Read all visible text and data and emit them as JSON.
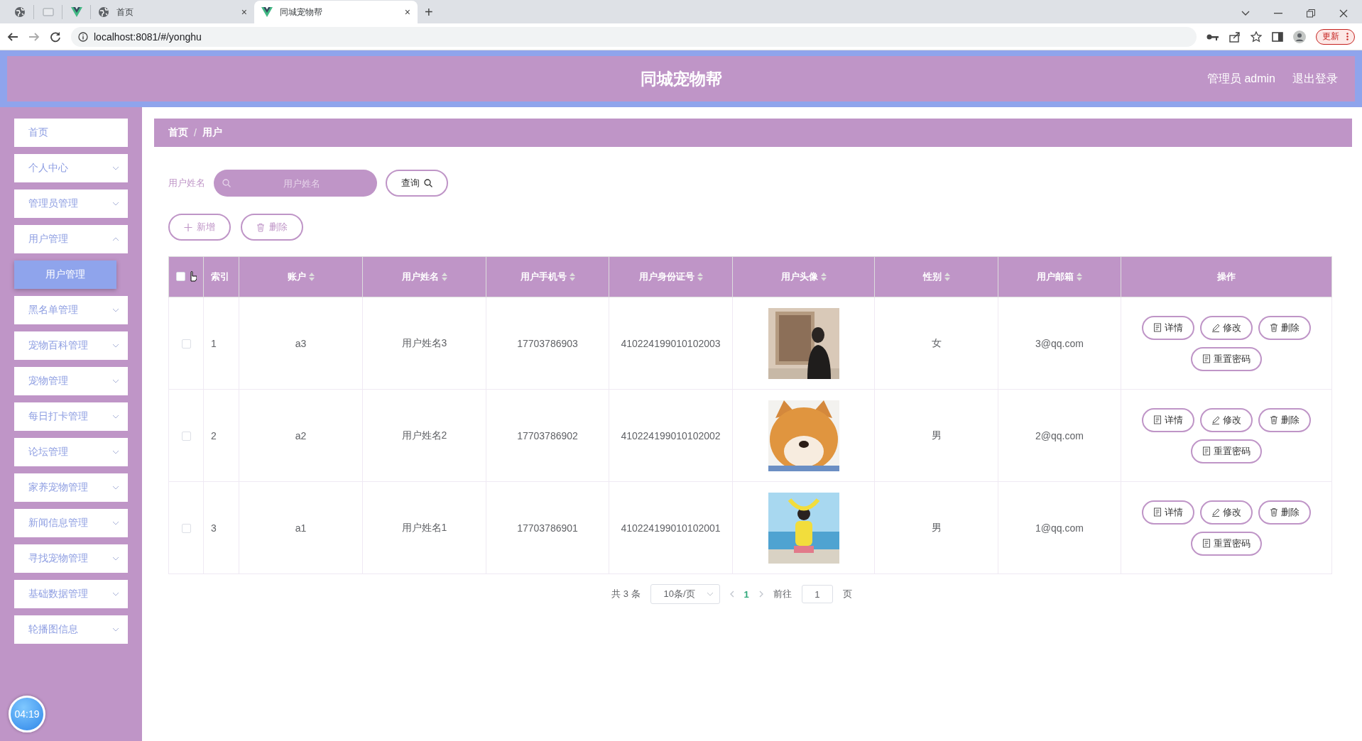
{
  "browser": {
    "tabs": [
      {
        "kind": "globe",
        "selected": false
      },
      {
        "kind": "blank",
        "selected": false
      },
      {
        "kind": "vue",
        "selected": false
      },
      {
        "kind": "globe",
        "title": "首页",
        "close": "×",
        "selected": false
      },
      {
        "kind": "vue",
        "title": "同城宠物帮",
        "close": "×",
        "selected": true
      }
    ],
    "new_tab": "+",
    "url": "localhost:8081/#/yonghu",
    "update_button": "更新"
  },
  "header": {
    "title": "同城宠物帮",
    "user": "管理员 admin",
    "logout": "退出登录"
  },
  "sidebar": {
    "items": [
      {
        "label": "首页",
        "kind": "link"
      },
      {
        "label": "个人中心",
        "kind": "menu",
        "expanded": false
      },
      {
        "label": "管理员管理",
        "kind": "menu",
        "expanded": false
      },
      {
        "label": "用户管理",
        "kind": "menu",
        "expanded": true,
        "children": [
          {
            "label": "用户管理",
            "selected": true
          }
        ]
      },
      {
        "label": "黑名单管理",
        "kind": "menu",
        "expanded": false
      },
      {
        "label": "宠物百科管理",
        "kind": "menu",
        "expanded": false
      },
      {
        "label": "宠物管理",
        "kind": "menu",
        "expanded": false
      },
      {
        "label": "每日打卡管理",
        "kind": "menu",
        "expanded": false
      },
      {
        "label": "论坛管理",
        "kind": "menu",
        "expanded": false
      },
      {
        "label": "家养宠物管理",
        "kind": "menu",
        "expanded": false
      },
      {
        "label": "新闻信息管理",
        "kind": "menu",
        "expanded": false
      },
      {
        "label": "寻找宠物管理",
        "kind": "menu",
        "expanded": false
      },
      {
        "label": "基础数据管理",
        "kind": "menu",
        "expanded": false
      },
      {
        "label": "轮播图信息",
        "kind": "menu",
        "expanded": false
      }
    ],
    "clock": "04:19"
  },
  "breadcrumb": [
    "首页",
    "/",
    "用户"
  ],
  "search": {
    "label": "用户姓名",
    "placeholder": "用户姓名",
    "button": "查询"
  },
  "toolbar": [
    "新增",
    "删除"
  ],
  "table": {
    "select_all": {
      "checked": false
    },
    "columns": [
      {
        "label": "索引",
        "sortable": false
      },
      {
        "label": "账户",
        "sortable": true
      },
      {
        "label": "用户姓名",
        "sortable": true
      },
      {
        "label": "用户手机号",
        "sortable": true
      },
      {
        "label": "用户身份证号",
        "sortable": true
      },
      {
        "label": "用户头像",
        "sortable": true
      },
      {
        "label": "性别",
        "sortable": true
      },
      {
        "label": "用户邮箱",
        "sortable": true
      },
      {
        "label": "操作",
        "sortable": false
      }
    ],
    "rows": [
      {
        "checked": false,
        "index": "1",
        "account": "a3",
        "name": "用户姓名3",
        "phone": "17703786903",
        "id_number": "410224199010102003",
        "avatar": {
          "kind": "picture"
        },
        "gender": "女",
        "email": "3@qq.com",
        "actions": [
          "详情",
          "修改",
          "删除",
          "重置密码"
        ]
      },
      {
        "checked": false,
        "index": "2",
        "account": "a2",
        "name": "用户姓名2",
        "phone": "17703786902",
        "id_number": "410224199010102002",
        "avatar": {
          "kind": "picture"
        },
        "gender": "男",
        "email": "2@qq.com",
        "actions": [
          "详情",
          "修改",
          "删除",
          "重置密码"
        ]
      },
      {
        "checked": false,
        "index": "3",
        "account": "a1",
        "name": "用户姓名1",
        "phone": "17703786901",
        "id_number": "410224199010102001",
        "avatar": {
          "kind": "picture"
        },
        "gender": "男",
        "email": "1@qq.com",
        "actions": [
          "详情",
          "修改",
          "删除",
          "重置密码"
        ]
      }
    ]
  },
  "pagination": {
    "total": "共 3 条",
    "page_size": "10条/页",
    "pages": [
      {
        "label": "1",
        "selected": true
      }
    ],
    "goto_label": "前往",
    "goto_value": "1",
    "goto_suffix": "页"
  }
}
